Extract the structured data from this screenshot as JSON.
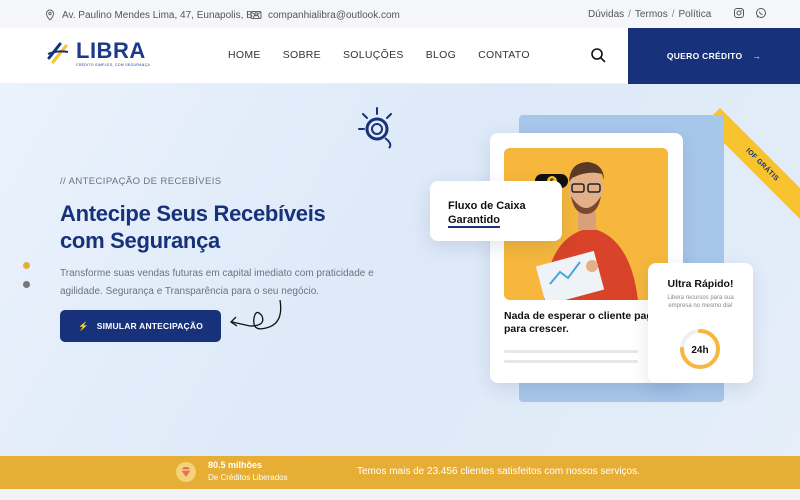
{
  "topbar": {
    "address": "Av. Paulino Mendes Lima, 47, Eunapolis, BA",
    "email": "companhialibra@outlook.com",
    "links": [
      "Dúvidas",
      "Termos",
      "Política"
    ],
    "social_icons": [
      "instagram-icon",
      "whatsapp-icon"
    ]
  },
  "header": {
    "logo_text": "LIBRA",
    "logo_tagline": "CRÉDITO SIMPLES, COM SEGURANÇA",
    "nav": [
      "HOME",
      "SOBRE",
      "SOLUÇÕES",
      "BLOG",
      "CONTATO"
    ],
    "cta_label": "QUERO CRÉDITO"
  },
  "hero": {
    "ribbon": "IOF GRÁTIS",
    "eyebrow": "// ANTECIPAÇÃO DE RECEBÍVEIS",
    "title": "Antecipe Seus Recebíveis com Segurança",
    "subtitle": "Transforme suas vendas futuras em capital imediato com praticidade e agilidade. Segurança e Transparência para o seu negócio.",
    "button_label": "SIMULAR ANTECIPAÇÃO"
  },
  "cards": {
    "cashflow_line1": "Fluxo de Caixa",
    "cashflow_line2": "Garantido",
    "main_line1": "Nada de esperar o cliente pagar",
    "main_line2": "para crescer.",
    "speed_title": "Ultra Rápido!",
    "speed_desc": "Libera recursos para sua empresa no mesmo dia!",
    "speed_value": "24h",
    "speed_progress": 0.75
  },
  "stats": {
    "value": "80.5 milhões",
    "label": "De Créditos Liberados",
    "message": "Temos mais de 23.456 clientes satisfeitos com nossos serviços."
  },
  "colors": {
    "brand_blue": "#17317a",
    "accent_yellow": "#f7c32e",
    "stat_bar": "#e6ae34"
  }
}
